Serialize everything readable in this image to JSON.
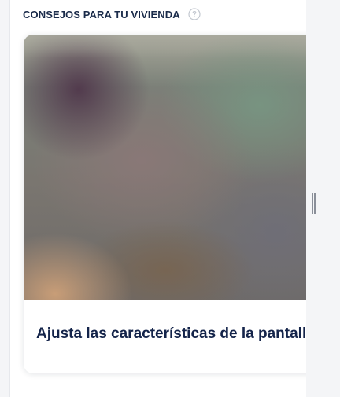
{
  "section": {
    "title": "CONSEJOS PARA TU VIVIENDA",
    "help_icon": "question-circle-icon"
  },
  "cards": [
    {
      "title": "Ajusta las características de la pantalla"
    }
  ],
  "colors": {
    "title_text": "#1a2b4a",
    "card_title_text": "#14244a",
    "panel_background": "#ffffff",
    "page_background": "#f4f5f7"
  }
}
